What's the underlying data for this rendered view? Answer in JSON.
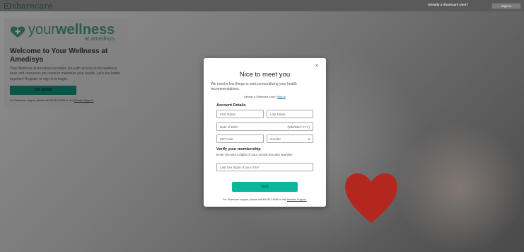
{
  "header": {
    "logo_text": "sharecare",
    "already_user": "Already a Sharecare User?",
    "sign_in": "Sign In"
  },
  "welcome": {
    "logo_your": "your",
    "logo_wellness": "wellness",
    "logo_sub": "at amedisys",
    "title": "Welcome to Your Wellness at Amedisys",
    "body": "Your Wellness at Amedisys provides you with access to the wellness tools and resources you need to maximize your health. Let's live better together! Register or sign in to begin.",
    "cta": "Get started",
    "support_prefix": "For Sharecare support, please call 800-821-6089 or visit",
    "support_link": "Member Support."
  },
  "modal": {
    "title": "Nice to meet you",
    "intro": "We need a few things to start personalizing your health recommendations.",
    "already_prefix": "Already a Sharecare User?",
    "already_link": "Sign In",
    "account_heading": "Account Details",
    "first_name_placeholder": "First Name",
    "last_name_placeholder": "Last Name",
    "dob_placeholder": "Date of Birth",
    "dob_format": "(MM/DD/YYYY)",
    "zip_placeholder": "ZIP Code",
    "gender_placeholder": "Gender",
    "verify_heading": "Verify your membership",
    "ssn_description": "Enter the last 4 digits of your Social Security Number.",
    "ssn_placeholder": "Last four digits of your SSN",
    "next_label": "Next",
    "support_prefix": "For Sharecare support, please call 800-821-6089 or visit",
    "support_link": "Member Support."
  },
  "icons": {
    "close": "close-icon",
    "gender_chevron": "chevron-down-icon",
    "heart_logo": "heart-plus-icon"
  },
  "colors": {
    "brand_green": "#0a5448",
    "next_teal": "#0ab69c"
  }
}
